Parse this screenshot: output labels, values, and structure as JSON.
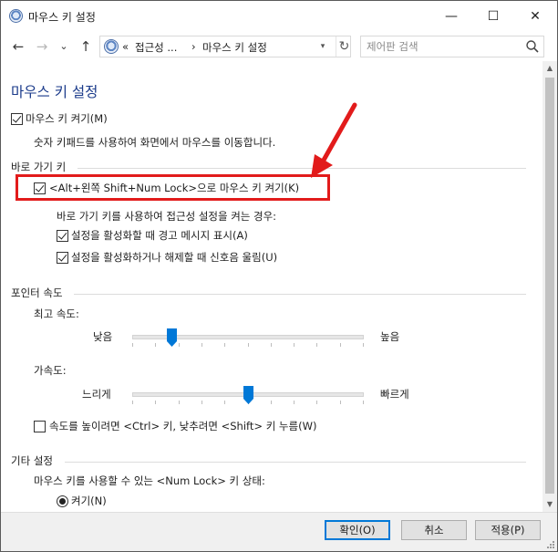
{
  "window": {
    "title": "마우스 키 설정",
    "minimize_glyph": "—",
    "maximize_glyph": "☐",
    "close_glyph": "✕"
  },
  "nav": {
    "back_glyph": "←",
    "forward_glyph": "→",
    "recent_glyph": "⌄",
    "up_glyph": "↑",
    "address_prefix": "«",
    "address_parent": "접근성 ...",
    "address_sep": "›",
    "address_current": "마우스 키 설정",
    "address_dropdown_glyph": "▾",
    "refresh_glyph": "↻",
    "search_placeholder": "제어판 검색"
  },
  "content": {
    "page_title": "마우스 키 설정",
    "mouse_keys": {
      "label": "마우스 키 켜기(M)",
      "checked": true,
      "description": "숫자 키패드를 사용하여 화면에서 마우스를 이동합니다."
    },
    "shortcut": {
      "heading": "바로 가기 키",
      "toggle_label": "<Alt+왼쪽 Shift+Num Lock>으로 마우스 키 켜기(K)",
      "toggle_checked": true,
      "sub_heading": "바로 가기 키를 사용하여 접근성 설정을 켜는 경우:",
      "warning_label": "설정을 활성화할 때 경고 메시지 표시(A)",
      "warning_checked": true,
      "sound_label": "설정을 활성화하거나 해제할 때 신호음 울림(U)",
      "sound_checked": true
    },
    "pointer_speed": {
      "heading": "포인터 속도",
      "top_speed_label": "최고 속도:",
      "top_speed_low": "낮음",
      "top_speed_high": "높음",
      "top_speed_value": 0.17,
      "accel_label": "가속도:",
      "accel_low": "느리게",
      "accel_high": "빠르게",
      "accel_value": 0.5,
      "ctrl_shift_label": "속도를 높이려면 <Ctrl> 키, 낮추려면 <Shift> 키 누름(W)",
      "ctrl_shift_checked": false
    },
    "other": {
      "heading": "기타 설정",
      "numlock_label": "마우스 키를 사용할 수 있는 <Num Lock> 키 상태:",
      "numlock_on_label": "켜기(N)",
      "numlock_on_selected": true
    }
  },
  "footer": {
    "ok_label": "확인(O)",
    "cancel_label": "취소",
    "apply_label": "적용(P)"
  },
  "colors": {
    "title_blue": "#1a3a8a",
    "slider_thumb": "#0078d7",
    "annotation_red": "#e21b1b"
  }
}
